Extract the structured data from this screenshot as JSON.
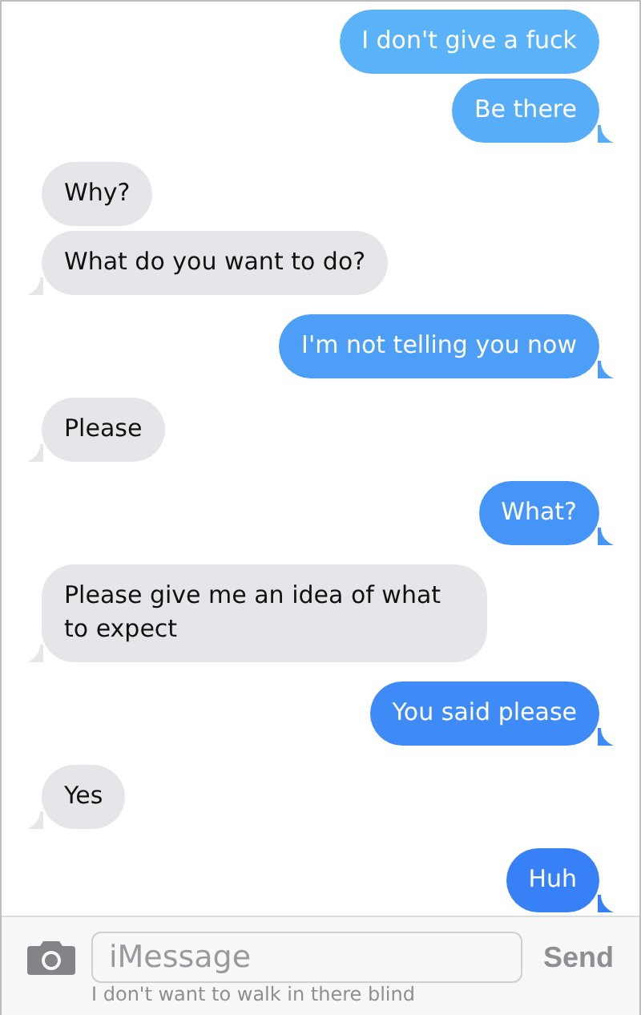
{
  "messages": [
    {
      "kind": "sent",
      "text": "I don't give a fuck",
      "tail": false
    },
    {
      "kind": "sent",
      "text": "Be there",
      "tail": true
    },
    {
      "kind": "received",
      "text": "Why?",
      "tail": false
    },
    {
      "kind": "received",
      "text": "What do you want to do?",
      "tail": true
    },
    {
      "kind": "sent",
      "text": "I'm not telling you now",
      "tail": true
    },
    {
      "kind": "received",
      "text": "Please",
      "tail": true
    },
    {
      "kind": "sent",
      "text": "What?",
      "tail": true
    },
    {
      "kind": "received",
      "text": "Please give me an idea of what to expect",
      "tail": true
    },
    {
      "kind": "sent",
      "text": "You said please",
      "tail": true
    },
    {
      "kind": "received",
      "text": "Yes",
      "tail": true
    },
    {
      "kind": "sent",
      "text": "Huh",
      "tail": true
    }
  ],
  "composer": {
    "placeholder": "iMessage",
    "draft_text": "I don't want to walk in there blind",
    "send": "Send"
  }
}
